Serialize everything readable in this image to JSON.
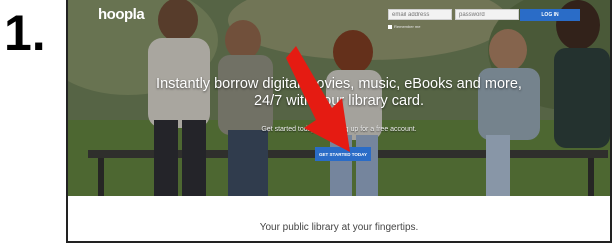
{
  "step_label": "1.",
  "app": {
    "logo_text": "hoopla"
  },
  "header": {
    "email_placeholder": "email address",
    "password_placeholder": "password",
    "login_label": "LOG IN",
    "remember_label": "Remember me"
  },
  "hero": {
    "headline_line1": "Instantly borrow digital movies, music, eBooks and more,",
    "headline_line2": "24/7 with your library card.",
    "subtext": "Get started today by signing up for a free account.",
    "cta_label": "GET STARTED TODAY"
  },
  "footer": {
    "tagline": "Your public library at your fingertips."
  },
  "colors": {
    "accent": "#2a6cc7",
    "arrow": "#e51b12"
  },
  "icons": {
    "pointer_arrow": "red-arrow-icon"
  }
}
